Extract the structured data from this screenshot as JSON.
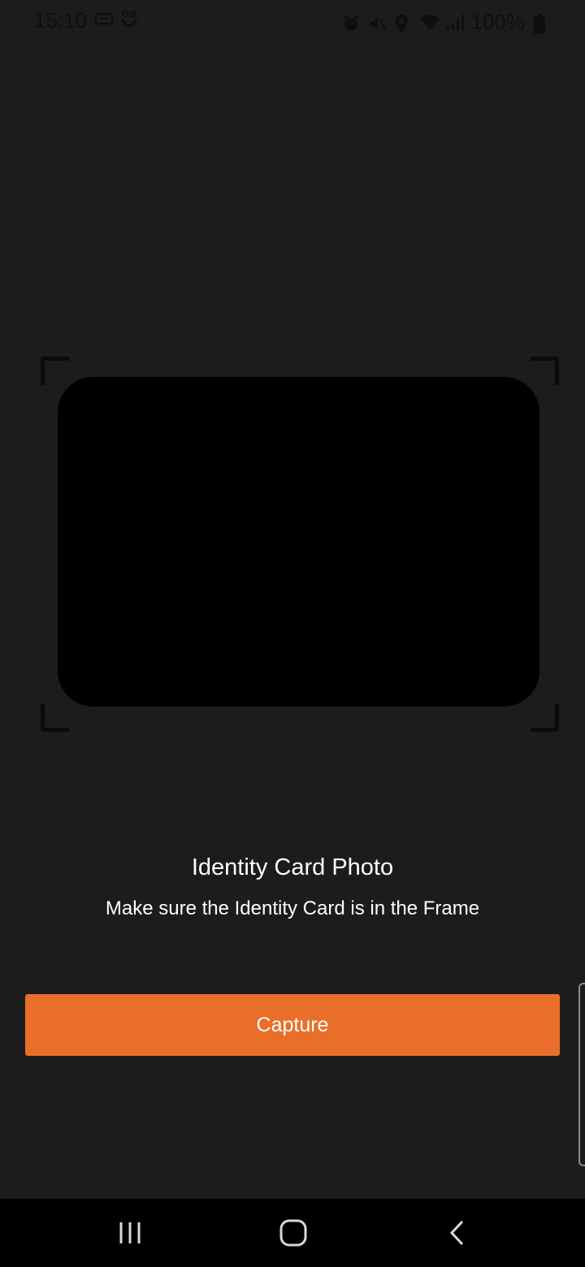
{
  "status_bar": {
    "time": "15:10",
    "battery": "100%",
    "icons": [
      "keyboard-icon",
      "accessibility-icon",
      "alarm-icon",
      "mute-icon",
      "location-icon",
      "wifi-icon",
      "signal-icon",
      "battery-icon"
    ]
  },
  "capture": {
    "title": "Identity Card Photo",
    "instruction": "Make sure the Identity Card is in the Frame",
    "button_label": "Capture"
  },
  "colors": {
    "background": "#1b1c1b",
    "accent": "#e86e2a",
    "nav_bar": "#000000"
  },
  "nav_bar": {
    "buttons": [
      "recent-apps-icon",
      "home-icon",
      "back-icon"
    ]
  }
}
